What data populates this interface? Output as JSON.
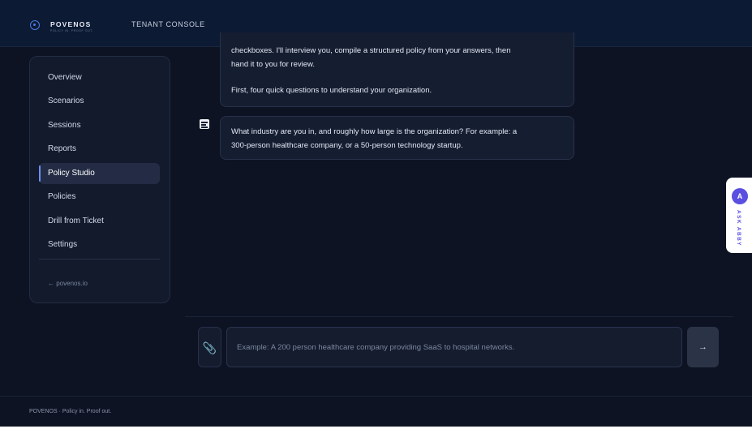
{
  "header": {
    "brand": "POVENOS",
    "brand_tagline": "POLICY IN. PROOF OUT.",
    "console_title": "TENANT CONSOLE"
  },
  "sidebar": {
    "items": [
      {
        "label": "Overview",
        "active": false
      },
      {
        "label": "Scenarios",
        "active": false
      },
      {
        "label": "Sessions",
        "active": false
      },
      {
        "label": "Reports",
        "active": false
      },
      {
        "label": "Policy Studio",
        "active": true
      },
      {
        "label": "Policies",
        "active": false
      },
      {
        "label": "Drill from Ticket",
        "active": false
      },
      {
        "label": "Settings",
        "active": false
      }
    ],
    "back_link": "← povenos.io"
  },
  "chat": {
    "messages": [
      {
        "line1": "checkboxes. I'll interview you, compile a structured policy from your answers, then",
        "line2": "hand it to you for review.",
        "line3": "First, four quick questions to understand your organization."
      },
      {
        "line1": "What industry are you in, and roughly how large is the organization? For example: a",
        "line2": "300-person healthcare company, or a 50-person technology startup."
      }
    ],
    "input_placeholder": "Example: A 200 person healthcare company providing SaaS to hospital networks.",
    "input_value": "",
    "send_glyph": "→",
    "attach_glyph": "📎"
  },
  "assistant_tab": {
    "avatar_letter": "A",
    "label": "ASK ABBY"
  },
  "footer": {
    "text": "POVENOS · Policy in. Proof out."
  },
  "colors": {
    "background": "#0d1322",
    "topbar": "#0c1a33",
    "accent": "#5a4fe0",
    "active_indicator": "#6c8ef0"
  }
}
